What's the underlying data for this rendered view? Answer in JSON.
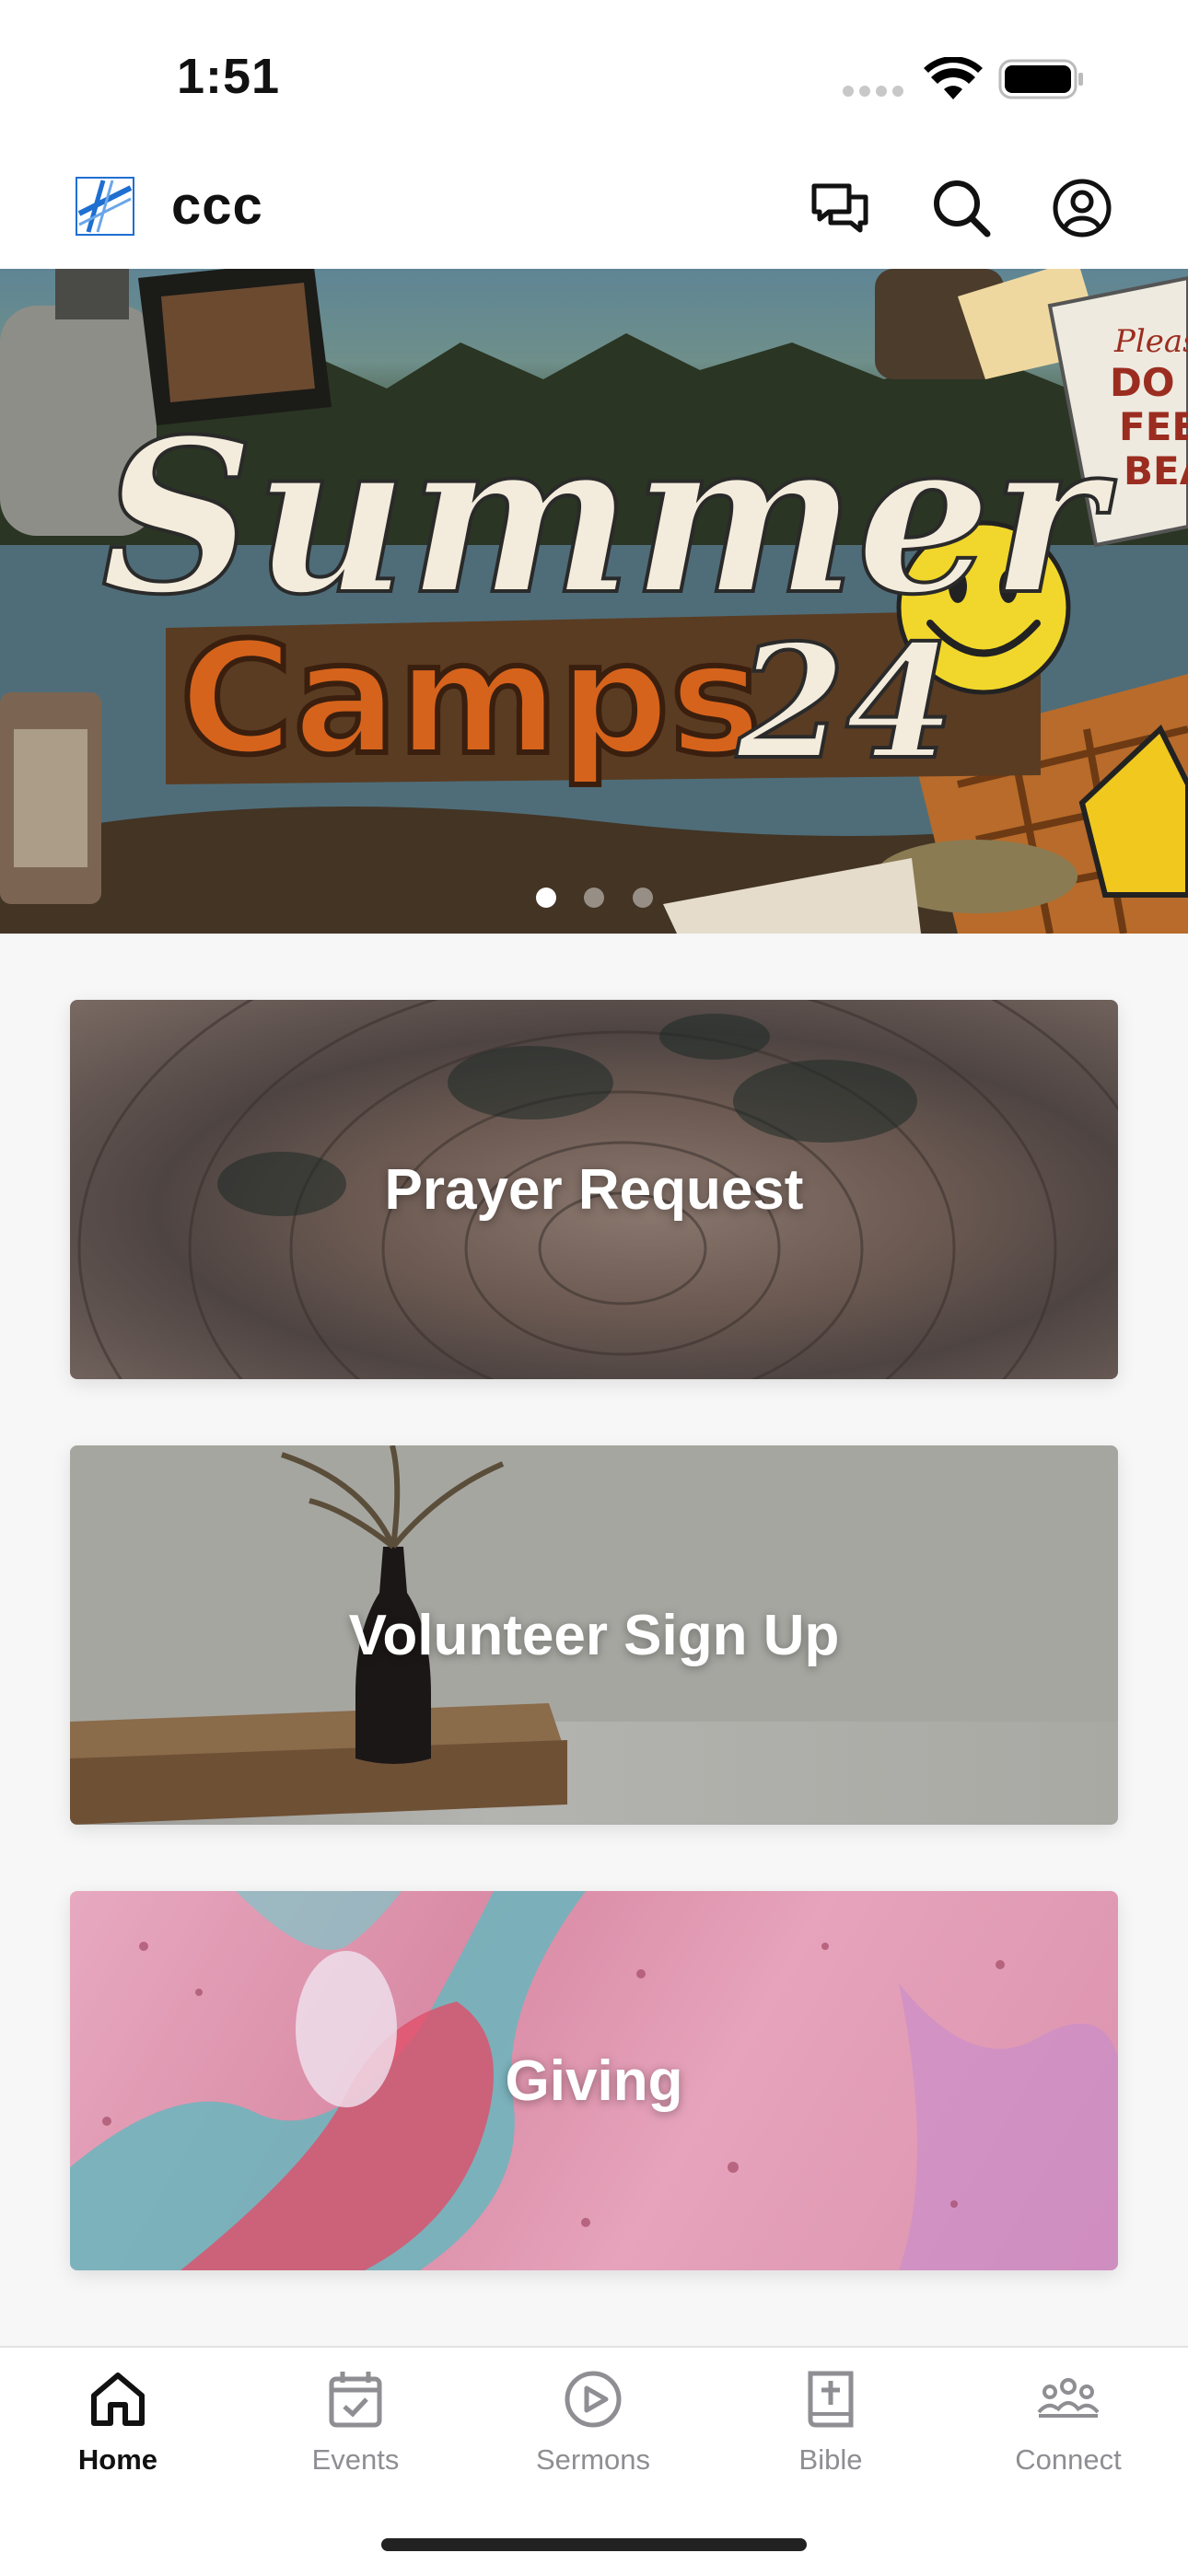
{
  "status_bar": {
    "time": "1:51"
  },
  "header": {
    "app_title": "ccc",
    "icons": [
      "logo-icon",
      "chat-icon",
      "search-icon",
      "profile-icon"
    ]
  },
  "hero": {
    "slides_count": 3,
    "active_slide": 1,
    "graphic_text": {
      "line1": "Summer",
      "line2": "Camps",
      "year": "24"
    },
    "sign_text": [
      "Please",
      "DO NOT",
      "FEED",
      "BEARS"
    ]
  },
  "cards": [
    {
      "label": "Prayer Request"
    },
    {
      "label": "Volunteer Sign Up"
    },
    {
      "label": "Giving"
    }
  ],
  "tab_bar": {
    "tabs": [
      {
        "label": "Home",
        "icon": "home-icon",
        "active": true
      },
      {
        "label": "Events",
        "icon": "calendar-icon",
        "active": false
      },
      {
        "label": "Sermons",
        "icon": "play-icon",
        "active": false
      },
      {
        "label": "Bible",
        "icon": "bible-icon",
        "active": false
      },
      {
        "label": "Connect",
        "icon": "people-icon",
        "active": false
      }
    ]
  },
  "colors": {
    "accent": "#111111",
    "inactive": "#8e8e93",
    "logo_blue": "#1f6fd1"
  }
}
